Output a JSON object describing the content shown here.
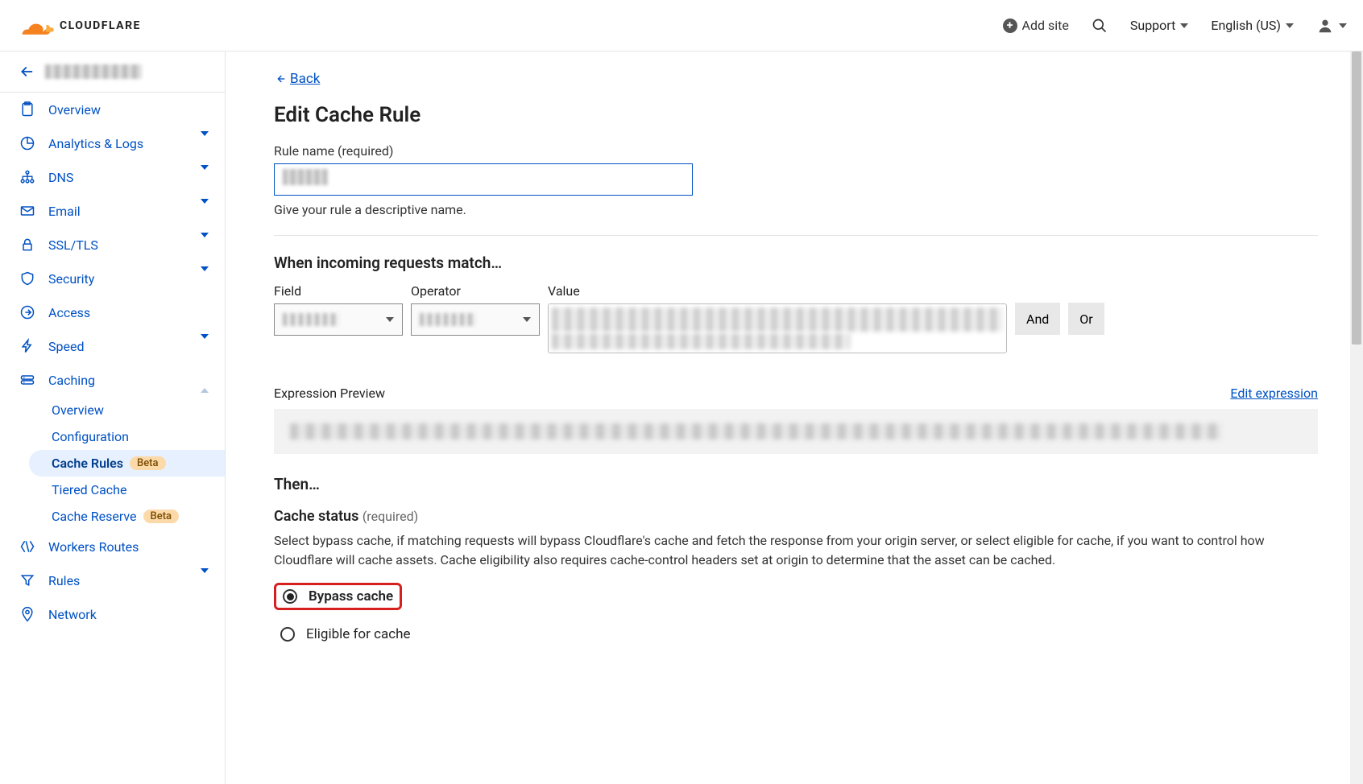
{
  "header": {
    "brand": "CLOUDFLARE",
    "add_site": "Add site",
    "support": "Support",
    "language": "English (US)"
  },
  "sidebar": {
    "site_name": "[redacted]",
    "items": [
      {
        "key": "overview",
        "label": "Overview",
        "icon": "clipboard",
        "expandable": false
      },
      {
        "key": "analytics",
        "label": "Analytics & Logs",
        "icon": "pie",
        "expandable": true
      },
      {
        "key": "dns",
        "label": "DNS",
        "icon": "sitemap",
        "expandable": true
      },
      {
        "key": "email",
        "label": "Email",
        "icon": "envelope",
        "expandable": true
      },
      {
        "key": "ssl",
        "label": "SSL/TLS",
        "icon": "lock",
        "expandable": true
      },
      {
        "key": "security",
        "label": "Security",
        "icon": "shield",
        "expandable": true
      },
      {
        "key": "access",
        "label": "Access",
        "icon": "enter",
        "expandable": false
      },
      {
        "key": "speed",
        "label": "Speed",
        "icon": "bolt",
        "expandable": true
      },
      {
        "key": "caching",
        "label": "Caching",
        "icon": "drive",
        "expandable": true,
        "expanded": true,
        "children": [
          {
            "key": "cache-overview",
            "label": "Overview"
          },
          {
            "key": "cache-config",
            "label": "Configuration"
          },
          {
            "key": "cache-rules",
            "label": "Cache Rules",
            "badge": "Beta",
            "active": true
          },
          {
            "key": "tiered",
            "label": "Tiered Cache"
          },
          {
            "key": "reserve",
            "label": "Cache Reserve",
            "badge": "Beta"
          }
        ]
      },
      {
        "key": "workers",
        "label": "Workers Routes",
        "icon": "workers",
        "expandable": false
      },
      {
        "key": "rules",
        "label": "Rules",
        "icon": "funnel",
        "expandable": true
      },
      {
        "key": "network",
        "label": "Network",
        "icon": "pin",
        "expandable": false
      }
    ]
  },
  "page": {
    "back": "Back",
    "title": "Edit Cache Rule",
    "rule_name_label": "Rule name (required)",
    "rule_name_value": "[redacted]",
    "rule_name_help": "Give your rule a descriptive name.",
    "match_title": "When incoming requests match…",
    "match_field_label": "Field",
    "match_operator_label": "Operator",
    "match_value_label": "Value",
    "match_field_value": "[redacted]",
    "match_operator_value": "[redacted]",
    "match_value_value": "[redacted]",
    "and_btn": "And",
    "or_btn": "Or",
    "expr_preview_label": "Expression Preview",
    "edit_expression": "Edit expression",
    "expr_preview_value": "[redacted]",
    "then_title": "Then…",
    "cache_status_label": "Cache status",
    "cache_status_required": "(required)",
    "cache_status_desc": "Select bypass cache, if matching requests will bypass Cloudflare's cache and fetch the response from your origin server, or select eligible for cache, if you want to control how Cloudflare will cache assets. Cache eligibility also requires cache-control headers set at origin to determine that the asset can be cached.",
    "radio_bypass": "Bypass cache",
    "radio_eligible": "Eligible for cache",
    "cache_status_selected": "bypass"
  }
}
